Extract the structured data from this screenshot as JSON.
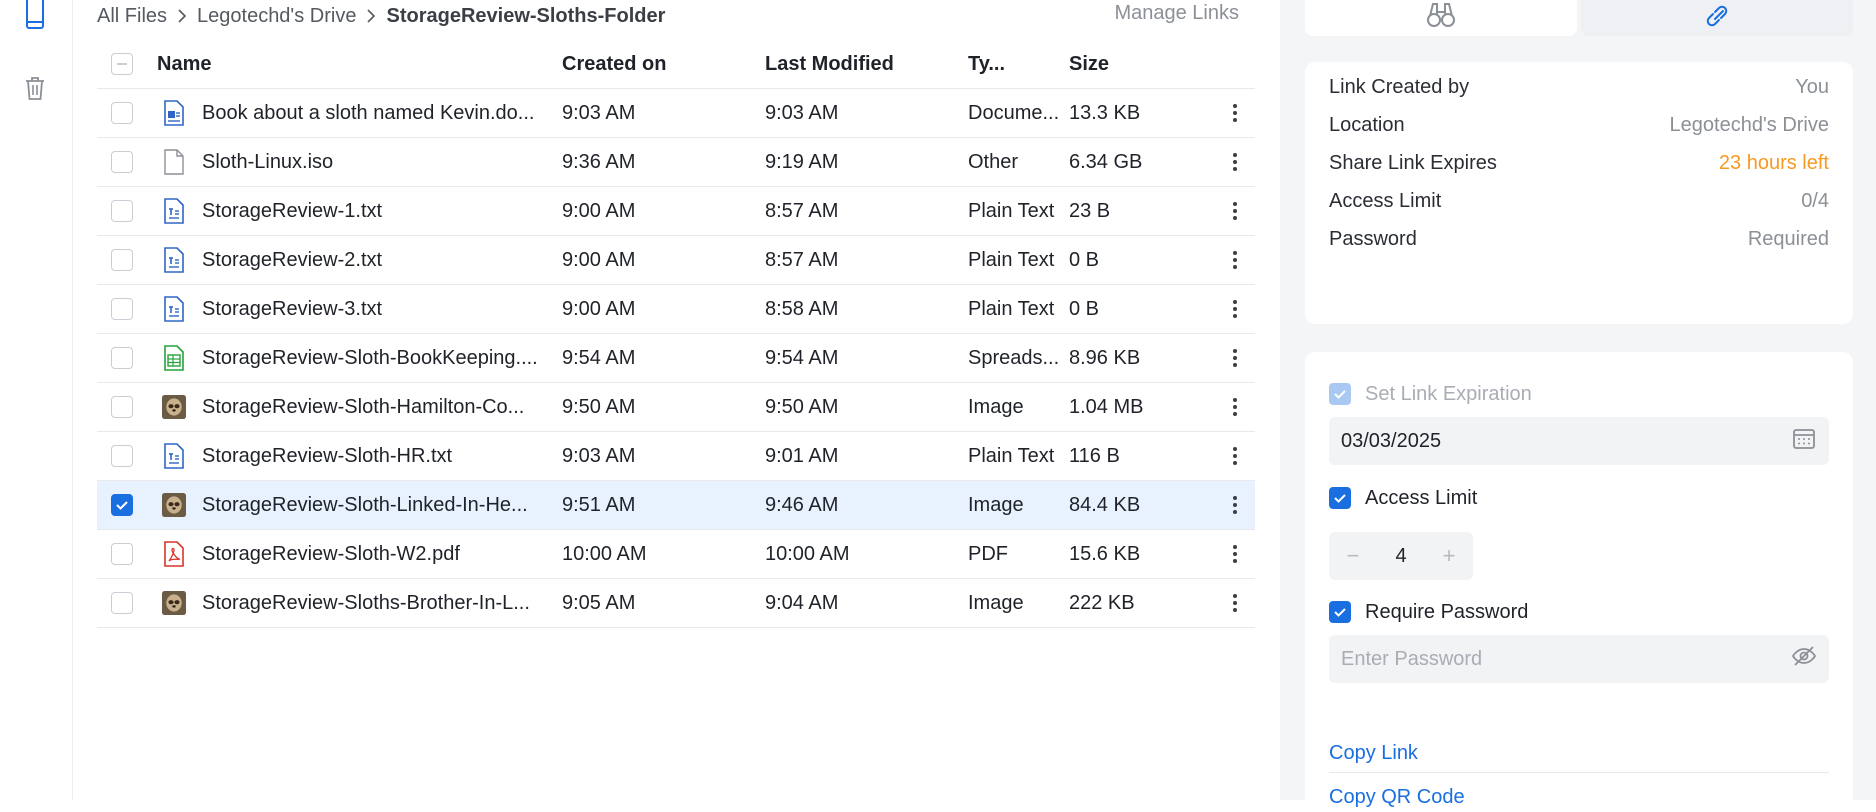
{
  "breadcrumb": {
    "items": [
      "All Files",
      "Legotechd's Drive",
      "StorageReview-Sloths-Folder"
    ],
    "manage_links": "Manage Links"
  },
  "table": {
    "headers": {
      "name": "Name",
      "created": "Created on",
      "modified": "Last Modified",
      "type": "Ty...",
      "size": "Size"
    },
    "rows": [
      {
        "icon": "doc",
        "name": "Book about a sloth named Kevin.do...",
        "created": "9:03 AM",
        "modified": "9:03 AM",
        "type": "Docume...",
        "size": "13.3 KB",
        "selected": false
      },
      {
        "icon": "generic",
        "name": "Sloth-Linux.iso",
        "created": "9:36 AM",
        "modified": "9:19 AM",
        "type": "Other",
        "size": "6.34 GB",
        "selected": false
      },
      {
        "icon": "text",
        "name": "StorageReview-1.txt",
        "created": "9:00 AM",
        "modified": "8:57 AM",
        "type": "Plain Text",
        "size": "23 B",
        "selected": false
      },
      {
        "icon": "text",
        "name": "StorageReview-2.txt",
        "created": "9:00 AM",
        "modified": "8:57 AM",
        "type": "Plain Text",
        "size": "0 B",
        "selected": false
      },
      {
        "icon": "text",
        "name": "StorageReview-3.txt",
        "created": "9:00 AM",
        "modified": "8:58 AM",
        "type": "Plain Text",
        "size": "0 B",
        "selected": false
      },
      {
        "icon": "sheet",
        "name": "StorageReview-Sloth-BookKeeping....",
        "created": "9:54 AM",
        "modified": "9:54 AM",
        "type": "Spreads...",
        "size": "8.96 KB",
        "selected": false
      },
      {
        "icon": "image",
        "name": "StorageReview-Sloth-Hamilton-Co...",
        "created": "9:50 AM",
        "modified": "9:50 AM",
        "type": "Image",
        "size": "1.04 MB",
        "selected": false
      },
      {
        "icon": "text",
        "name": "StorageReview-Sloth-HR.txt",
        "created": "9:03 AM",
        "modified": "9:01 AM",
        "type": "Plain Text",
        "size": "116 B",
        "selected": false
      },
      {
        "icon": "image",
        "name": "StorageReview-Sloth-Linked-In-He...",
        "created": "9:51 AM",
        "modified": "9:46 AM",
        "type": "Image",
        "size": "84.4 KB",
        "selected": true
      },
      {
        "icon": "pdf",
        "name": "StorageReview-Sloth-W2.pdf",
        "created": "10:00 AM",
        "modified": "10:00 AM",
        "type": "PDF",
        "size": "15.6 KB",
        "selected": false
      },
      {
        "icon": "image",
        "name": "StorageReview-Sloths-Brother-In-L...",
        "created": "9:05 AM",
        "modified": "9:04 AM",
        "type": "Image",
        "size": "222 KB",
        "selected": false
      }
    ]
  },
  "panel": {
    "info": [
      {
        "label": "Link Created by",
        "value": "You",
        "warn": false
      },
      {
        "label": "Location",
        "value": "Legotechd's Drive",
        "warn": false
      },
      {
        "label": "Share Link Expires",
        "value": "23 hours left",
        "warn": true
      },
      {
        "label": "Access Limit",
        "value": "0/4",
        "warn": false
      },
      {
        "label": "Password",
        "value": "Required",
        "warn": false
      }
    ],
    "set_expiration_label": "Set Link Expiration",
    "expiration_date": "03/03/2025",
    "access_limit_label": "Access Limit",
    "access_limit_value": "4",
    "require_password_label": "Require Password",
    "password_placeholder": "Enter Password",
    "copy_link": "Copy Link",
    "copy_qr": "Copy QR Code"
  },
  "colors": {
    "accent": "#1a6fe0",
    "warning": "#f59a23",
    "selected_row": "#e8f1fe"
  }
}
